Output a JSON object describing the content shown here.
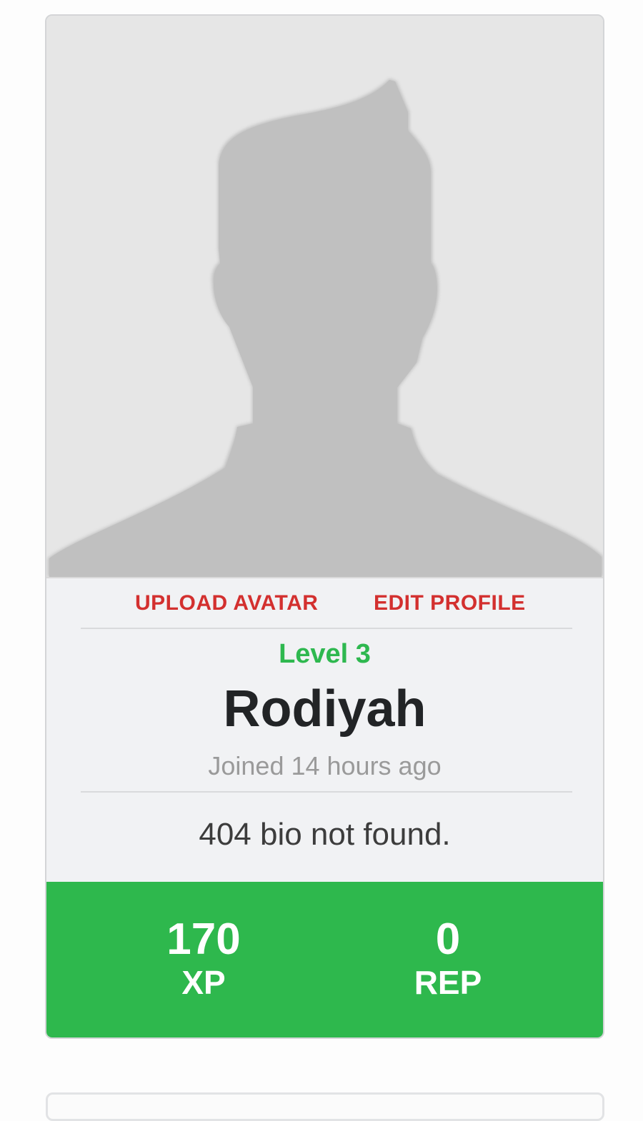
{
  "profile": {
    "actions": {
      "upload_avatar": "UPLOAD AVATAR",
      "edit_profile": "EDIT PROFILE"
    },
    "level": "Level 3",
    "username": "Rodiyah",
    "joined": "Joined 14 hours ago",
    "bio": "404 bio not found.",
    "stats": {
      "xp": {
        "value": "170",
        "label": "XP"
      },
      "rep": {
        "value": "0",
        "label": "REP"
      }
    }
  },
  "avatar": {
    "icon": "default-user-silhouette-icon"
  },
  "colors": {
    "accent_red": "#d3302f",
    "level_green": "#2eb84f",
    "stats_green": "#2eb84d",
    "avatar_bg": "#e6e6e6",
    "silhouette": "#c0c0c0"
  }
}
